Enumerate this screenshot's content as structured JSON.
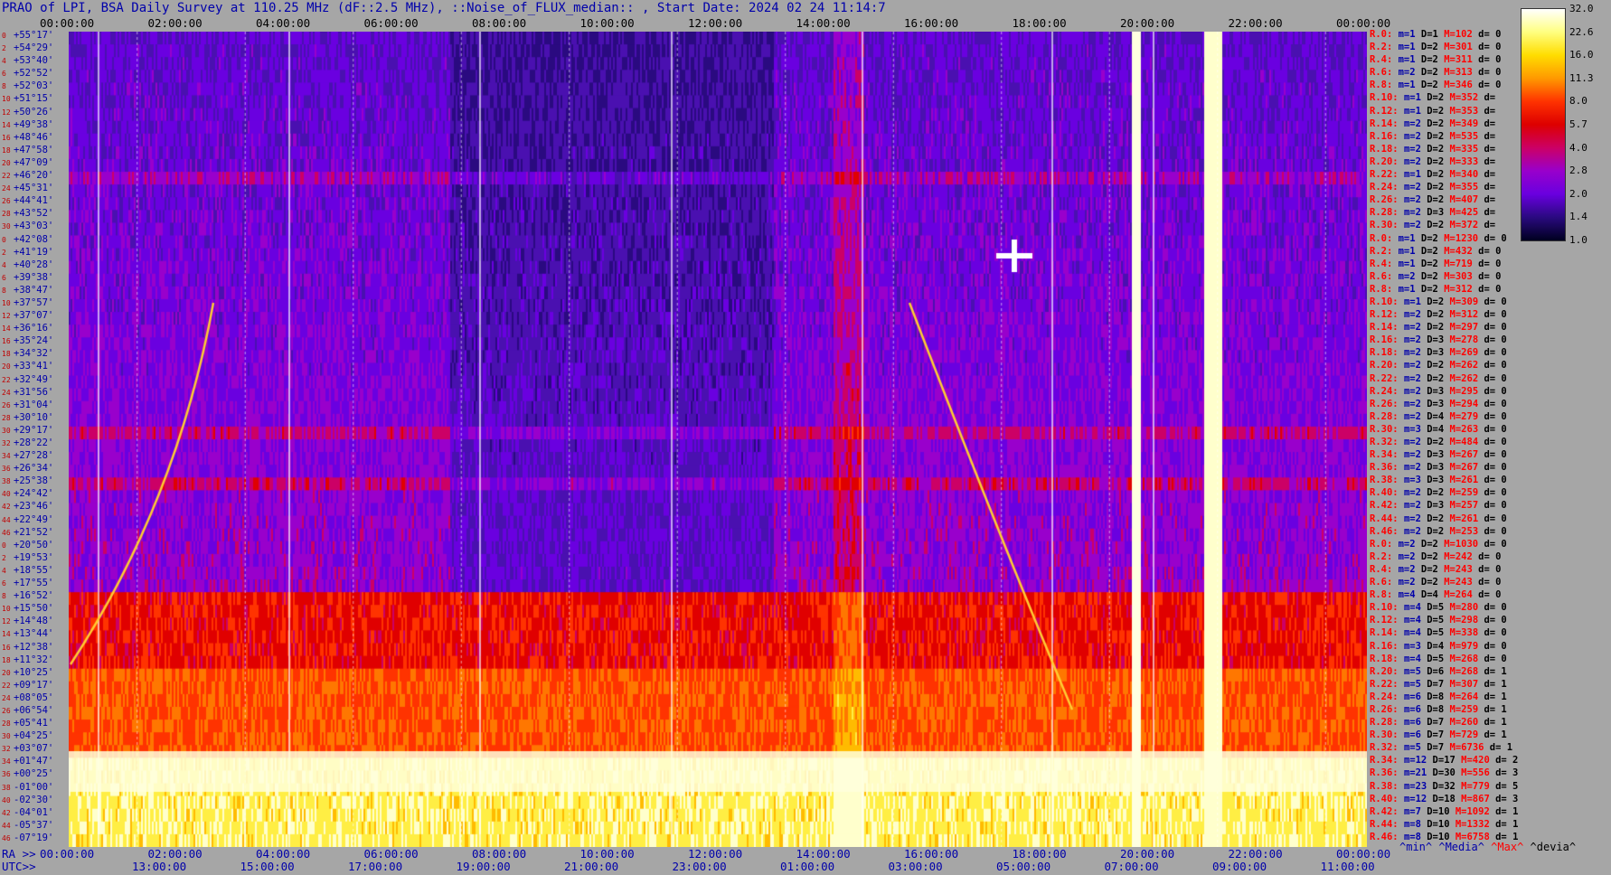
{
  "title": "PRAO of LPI, BSA Daily Survey at 110.25 MHz (dF::2.5 MHz), ::Noise_of_FLUX_median:: , Start Date: 2024 02 24 11:14:7",
  "chart_data": {
    "type": "heatmap",
    "title": "PRAO of LPI, BSA Daily Survey at 110.25 MHz (dF::2.5 MHz), ::Noise_of_FLUX_median:: , Start Date: 2024 02 24 11:14:7",
    "x_top_ticks": [
      "00:00:00",
      "02:00:00",
      "04:00:00",
      "06:00:00",
      "08:00:00",
      "10:00:00",
      "12:00:00",
      "14:00:00",
      "16:00:00",
      "18:00:00",
      "20:00:00",
      "22:00:00",
      "00:00:00"
    ],
    "x_bottom_ra_ticks": [
      "00:00:00",
      "02:00:00",
      "04:00:00",
      "06:00:00",
      "08:00:00",
      "10:00:00",
      "12:00:00",
      "14:00:00",
      "16:00:00",
      "18:00:00",
      "20:00:00",
      "22:00:00",
      "00:00:00"
    ],
    "x_bottom_utc_ticks": [
      "13:00:00",
      "15:00:00",
      "17:00:00",
      "19:00:00",
      "21:00:00",
      "23:00:00",
      "01:00:00",
      "03:00:00",
      "05:00:00",
      "07:00:00",
      "09:00:00",
      "11:00:00"
    ],
    "ra_label": "RA >>",
    "utc_label": "UTC>>",
    "declinations": [
      "+55°17'",
      "+54°29'",
      "+53°40'",
      "+52°52'",
      "+52°03'",
      "+51°15'",
      "+50°26'",
      "+49°38'",
      "+48°46'",
      "+47°58'",
      "+47°09'",
      "+46°20'",
      "+45°31'",
      "+44°41'",
      "+43°52'",
      "+43°03'",
      "+42°08'",
      "+41°19'",
      "+40°28'",
      "+39°38'",
      "+38°47'",
      "+37°57'",
      "+37°07'",
      "+36°16'",
      "+35°24'",
      "+34°32'",
      "+33°41'",
      "+32°49'",
      "+31°56'",
      "+31°04'",
      "+30°10'",
      "+29°17'",
      "+28°22'",
      "+27°28'",
      "+26°34'",
      "+25°38'",
      "+24°42'",
      "+23°46'",
      "+22°49'",
      "+21°52'",
      "+20°50'",
      "+19°53'",
      "+18°55'",
      "+17°55'",
      "+16°52'",
      "+15°50'",
      "+14°48'",
      "+13°44'",
      "+12°38'",
      "+11°32'",
      "+10°25'",
      "+09°17'",
      "+08°05'",
      "+06°54'",
      "+05°41'",
      "+04°25'",
      "+03°07'",
      "+01°47'",
      "+00°25'",
      "-01°00'",
      "-02°30'",
      "-04°01'",
      "-05°37'",
      "-07°19'"
    ],
    "row_numbers": [
      "0",
      "2",
      "4",
      "6",
      "8",
      "10",
      "12",
      "14",
      "16",
      "18",
      "20",
      "22",
      "24",
      "26",
      "28",
      "30",
      "0",
      "2",
      "4",
      "6",
      "8",
      "10",
      "12",
      "14",
      "16",
      "18",
      "20",
      "22",
      "24",
      "26",
      "28",
      "30",
      "32",
      "34",
      "36",
      "38",
      "40",
      "42",
      "44",
      "46",
      "0",
      "2",
      "4",
      "6",
      "8",
      "10",
      "12",
      "14",
      "16",
      "18",
      "20",
      "22",
      "24",
      "26",
      "28",
      "30",
      "32",
      "34",
      "36",
      "38",
      "40",
      "42",
      "44",
      "46"
    ],
    "colorbar": {
      "ticks": [
        "32.0",
        "22.6",
        "16.0",
        "11.3",
        "8.0",
        "5.7",
        "4.0",
        "2.8",
        "2.0",
        "1.4",
        "1.0"
      ],
      "colors": [
        "#ffffff",
        "#ffff80",
        "#ffdd00",
        "#ff9900",
        "#ff3300",
        "#dd0000",
        "#cc0066",
        "#9900cc",
        "#6a00e0",
        "#2a0a80",
        "#000020"
      ]
    },
    "stats": [
      [
        "R.0:",
        "m=1",
        "D=1",
        "M=102",
        "d= 0"
      ],
      [
        "R.2:",
        "m=1",
        "D=2",
        "M=301",
        "d= 0"
      ],
      [
        "R.4:",
        "m=1",
        "D=2",
        "M=311",
        "d= 0"
      ],
      [
        "R.6:",
        "m=2",
        "D=2",
        "M=313",
        "d= 0"
      ],
      [
        "R.8:",
        "m=1",
        "D=2",
        "M=346",
        "d= 0"
      ],
      [
        "R.10:",
        "m=1",
        "D=2",
        "M=352",
        "d="
      ],
      [
        "R.12:",
        "m=1",
        "D=2",
        "M=353",
        "d="
      ],
      [
        "R.14:",
        "m=2",
        "D=2",
        "M=349",
        "d="
      ],
      [
        "R.16:",
        "m=2",
        "D=2",
        "M=535",
        "d="
      ],
      [
        "R.18:",
        "m=2",
        "D=2",
        "M=335",
        "d="
      ],
      [
        "R.20:",
        "m=2",
        "D=2",
        "M=333",
        "d="
      ],
      [
        "R.22:",
        "m=1",
        "D=2",
        "M=340",
        "d="
      ],
      [
        "R.24:",
        "m=2",
        "D=2",
        "M=355",
        "d="
      ],
      [
        "R.26:",
        "m=2",
        "D=2",
        "M=407",
        "d="
      ],
      [
        "R.28:",
        "m=2",
        "D=3",
        "M=425",
        "d="
      ],
      [
        "R.30:",
        "m=2",
        "D=2",
        "M=372",
        "d="
      ],
      [
        "R.0:",
        "m=1",
        "D=2",
        "M=1230",
        "d= 0"
      ],
      [
        "R.2:",
        "m=1",
        "D=2",
        "M=432",
        "d= 0"
      ],
      [
        "R.4:",
        "m=1",
        "D=2",
        "M=719",
        "d= 0"
      ],
      [
        "R.6:",
        "m=2",
        "D=2",
        "M=303",
        "d= 0"
      ],
      [
        "R.8:",
        "m=1",
        "D=2",
        "M=312",
        "d= 0"
      ],
      [
        "R.10:",
        "m=1",
        "D=2",
        "M=309",
        "d= 0"
      ],
      [
        "R.12:",
        "m=2",
        "D=2",
        "M=312",
        "d= 0"
      ],
      [
        "R.14:",
        "m=2",
        "D=2",
        "M=297",
        "d= 0"
      ],
      [
        "R.16:",
        "m=2",
        "D=3",
        "M=278",
        "d= 0"
      ],
      [
        "R.18:",
        "m=2",
        "D=3",
        "M=269",
        "d= 0"
      ],
      [
        "R.20:",
        "m=2",
        "D=2",
        "M=262",
        "d= 0"
      ],
      [
        "R.22:",
        "m=2",
        "D=2",
        "M=262",
        "d= 0"
      ],
      [
        "R.24:",
        "m=2",
        "D=3",
        "M=295",
        "d= 0"
      ],
      [
        "R.26:",
        "m=2",
        "D=3",
        "M=294",
        "d= 0"
      ],
      [
        "R.28:",
        "m=2",
        "D=4",
        "M=279",
        "d= 0"
      ],
      [
        "R.30:",
        "m=3",
        "D=4",
        "M=263",
        "d= 0"
      ],
      [
        "R.32:",
        "m=2",
        "D=2",
        "M=484",
        "d= 0"
      ],
      [
        "R.34:",
        "m=2",
        "D=3",
        "M=267",
        "d= 0"
      ],
      [
        "R.36:",
        "m=2",
        "D=3",
        "M=267",
        "d= 0"
      ],
      [
        "R.38:",
        "m=3",
        "D=3",
        "M=261",
        "d= 0"
      ],
      [
        "R.40:",
        "m=2",
        "D=2",
        "M=259",
        "d= 0"
      ],
      [
        "R.42:",
        "m=2",
        "D=3",
        "M=257",
        "d= 0"
      ],
      [
        "R.44:",
        "m=2",
        "D=2",
        "M=261",
        "d= 0"
      ],
      [
        "R.46:",
        "m=2",
        "D=2",
        "M=253",
        "d= 0"
      ],
      [
        "R.0:",
        "m=2",
        "D=2",
        "M=1030",
        "d= 0"
      ],
      [
        "R.2:",
        "m=2",
        "D=2",
        "M=242",
        "d= 0"
      ],
      [
        "R.4:",
        "m=2",
        "D=2",
        "M=243",
        "d= 0"
      ],
      [
        "R.6:",
        "m=2",
        "D=2",
        "M=243",
        "d= 0"
      ],
      [
        "R.8:",
        "m=4",
        "D=4",
        "M=264",
        "d= 0"
      ],
      [
        "R.10:",
        "m=4",
        "D=5",
        "M=280",
        "d= 0"
      ],
      [
        "R.12:",
        "m=4",
        "D=5",
        "M=298",
        "d= 0"
      ],
      [
        "R.14:",
        "m=4",
        "D=5",
        "M=338",
        "d= 0"
      ],
      [
        "R.16:",
        "m=3",
        "D=4",
        "M=979",
        "d= 0"
      ],
      [
        "R.18:",
        "m=4",
        "D=5",
        "M=268",
        "d= 0"
      ],
      [
        "R.20:",
        "m=5",
        "D=6",
        "M=268",
        "d= 1"
      ],
      [
        "R.22:",
        "m=5",
        "D=7",
        "M=307",
        "d= 1"
      ],
      [
        "R.24:",
        "m=6",
        "D=8",
        "M=264",
        "d= 1"
      ],
      [
        "R.26:",
        "m=6",
        "D=8",
        "M=259",
        "d= 1"
      ],
      [
        "R.28:",
        "m=6",
        "D=7",
        "M=260",
        "d= 1"
      ],
      [
        "R.30:",
        "m=6",
        "D=7",
        "M=729",
        "d= 1"
      ],
      [
        "R.32:",
        "m=5",
        "D=7",
        "M=6736",
        "d= 1"
      ],
      [
        "R.34:",
        "m=12",
        "D=17",
        "M=420",
        "d= 2"
      ],
      [
        "R.36:",
        "m=21",
        "D=30",
        "M=556",
        "d= 3"
      ],
      [
        "R.38:",
        "m=23",
        "D=32",
        "M=779",
        "d= 5"
      ],
      [
        "R.40:",
        "m=12",
        "D=18",
        "M=867",
        "d= 3"
      ],
      [
        "R.42:",
        "m=7",
        "D=10",
        "M=1092",
        "d= 1"
      ],
      [
        "R.44:",
        "m=8",
        "D=10",
        "M=1332",
        "d= 1"
      ],
      [
        "R.46:",
        "m=8",
        "D=10",
        "M=6758",
        "d= 1"
      ]
    ],
    "legend": [
      "^min^",
      "^Media^",
      "^Max^",
      "^devia^"
    ]
  }
}
